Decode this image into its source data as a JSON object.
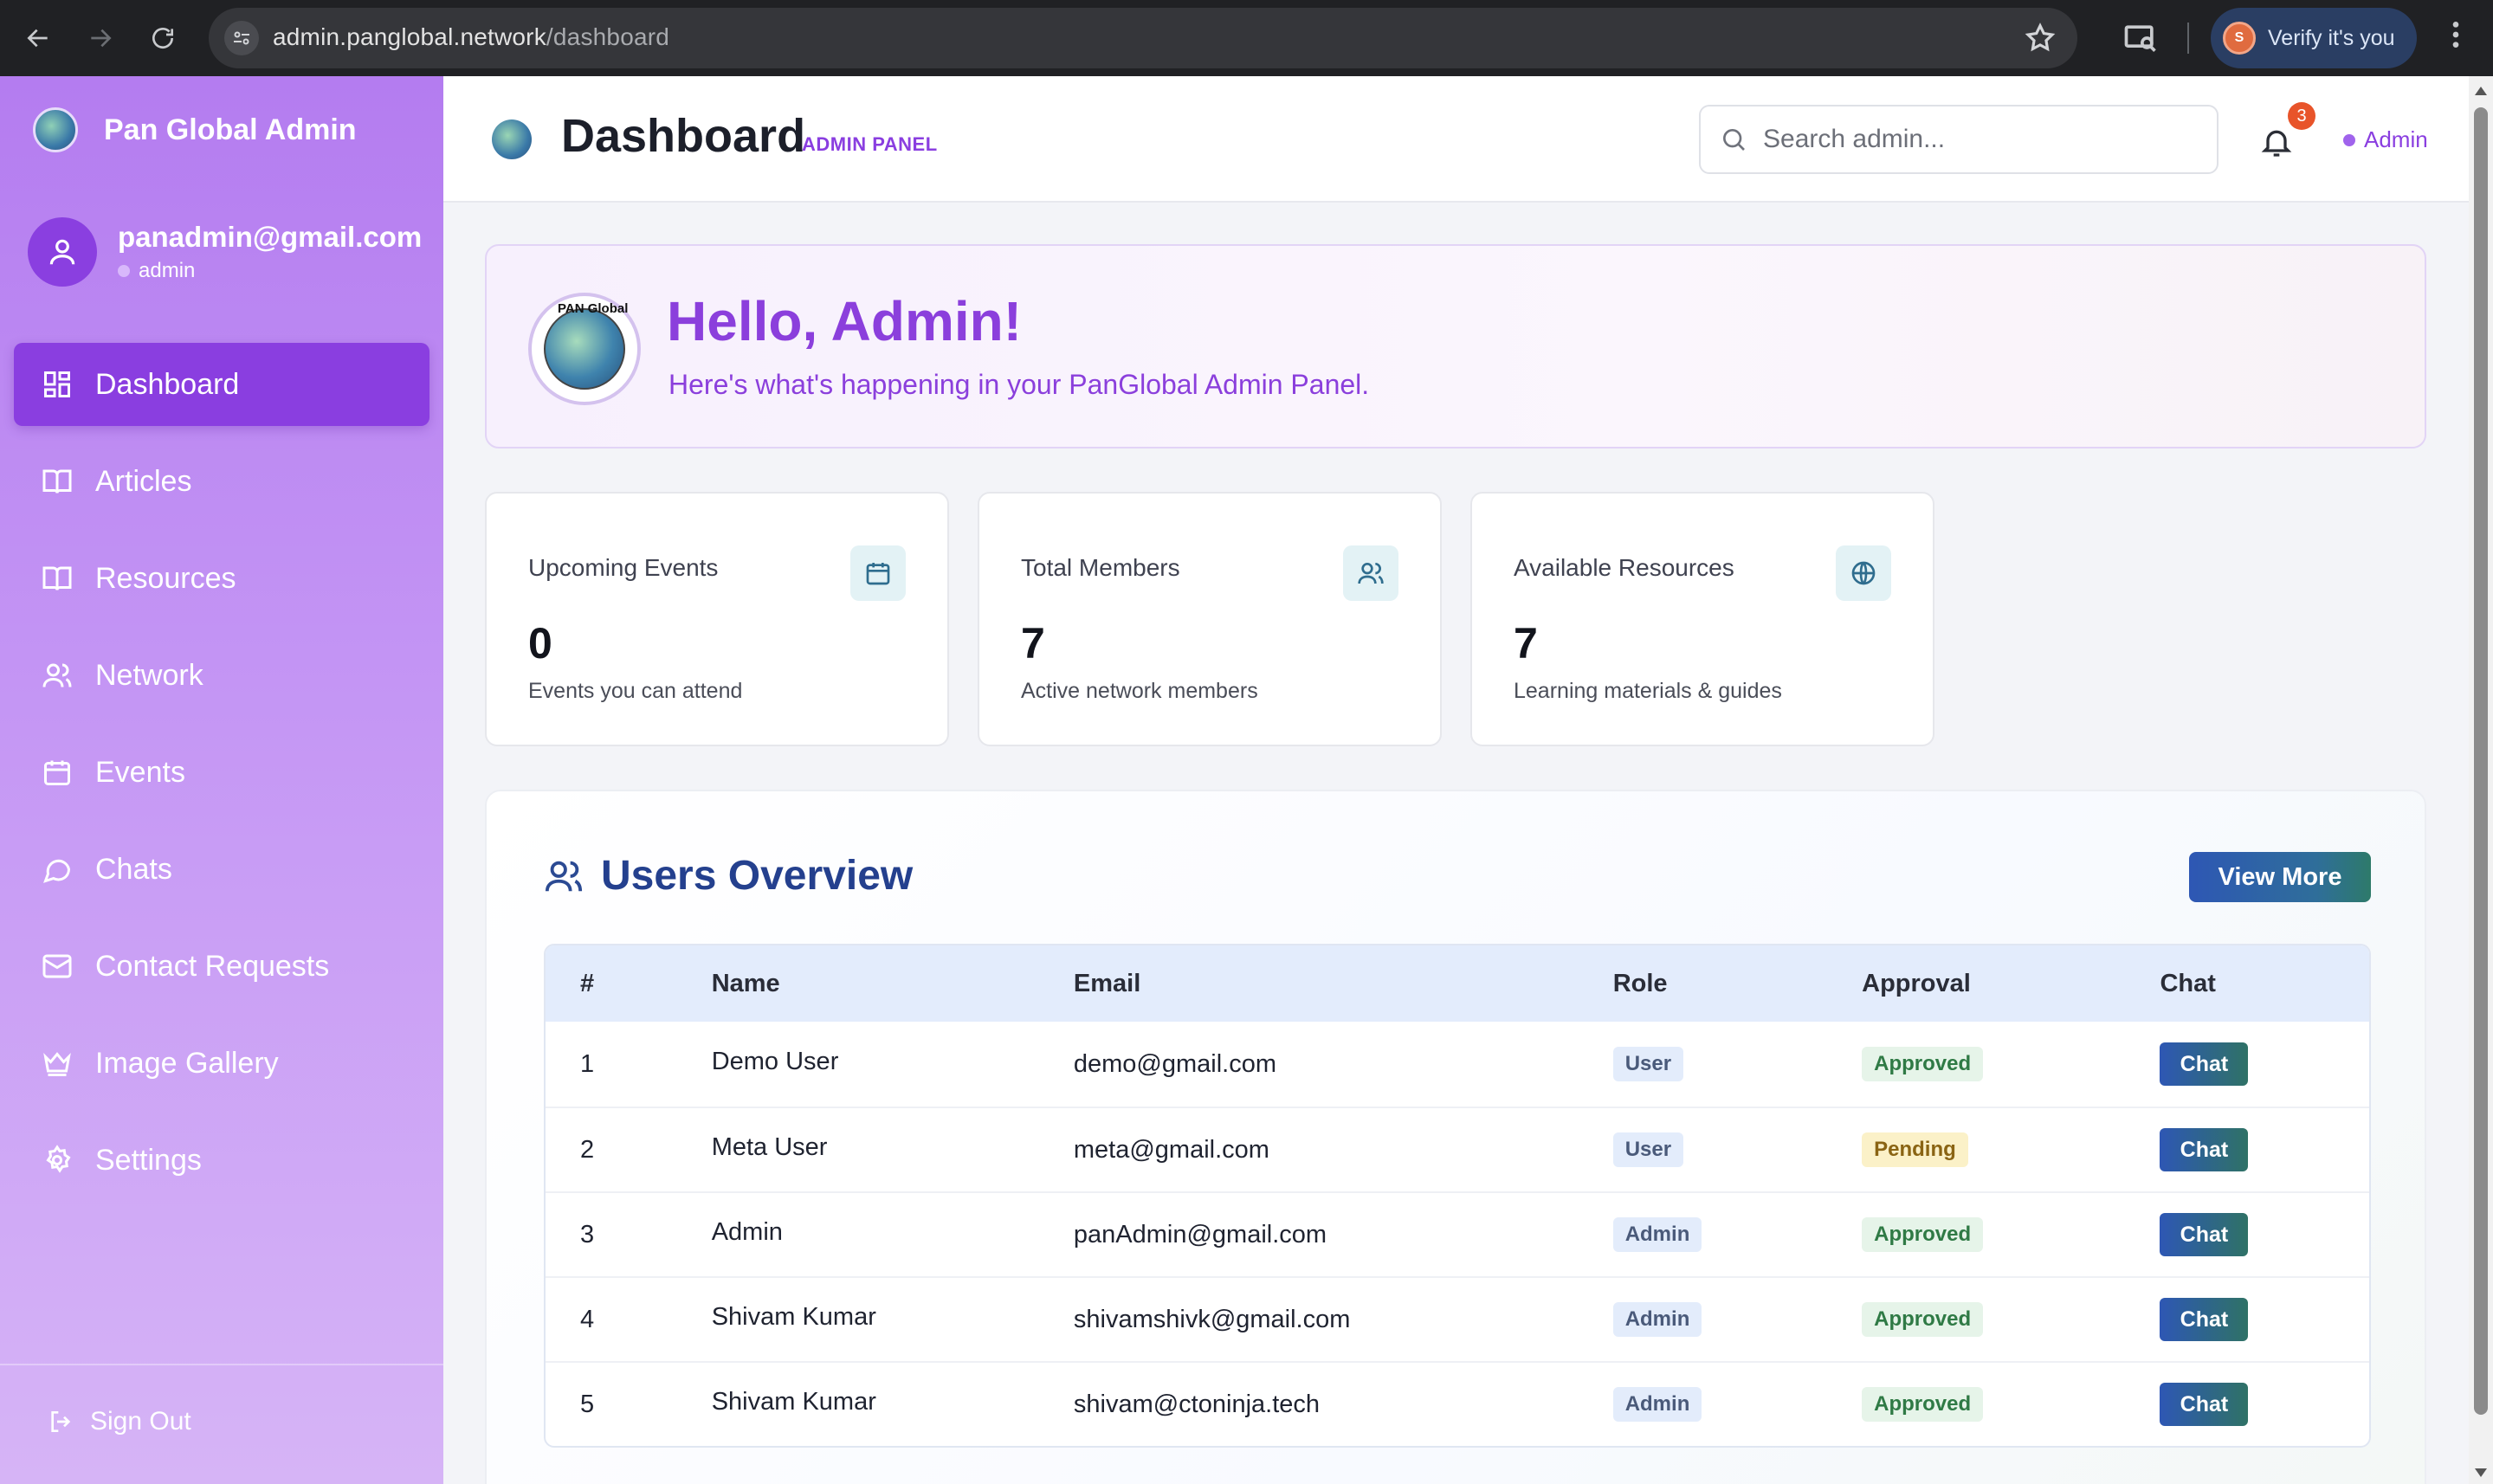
{
  "browser": {
    "url_host": "admin.panglobal.network",
    "url_path": "/dashboard",
    "profile_initial": "S",
    "verify_label": "Verify it's you"
  },
  "sidebar": {
    "brand": "Pan Global Admin",
    "user_email": "panadmin@gmail.com",
    "user_role": "admin",
    "items": [
      {
        "label": "Dashboard",
        "icon": "dashboard-icon",
        "active": true
      },
      {
        "label": "Articles",
        "icon": "book-icon"
      },
      {
        "label": "Resources",
        "icon": "book-icon"
      },
      {
        "label": "Network",
        "icon": "users-icon"
      },
      {
        "label": "Events",
        "icon": "calendar-icon"
      },
      {
        "label": "Chats",
        "icon": "chat-icon"
      },
      {
        "label": "Contact Requests",
        "icon": "mail-icon"
      },
      {
        "label": "Image Gallery",
        "icon": "crown-icon"
      },
      {
        "label": "Settings",
        "icon": "gear-icon"
      }
    ],
    "sign_out": "Sign Out"
  },
  "header": {
    "title": "Dashboard",
    "badge": "ADMIN PANEL",
    "search_placeholder": "Search admin...",
    "notification_count": "3",
    "user_label": "Admin"
  },
  "hello": {
    "seal_text": "PAN Global",
    "title": "Hello, Admin!",
    "subtitle": "Here's what's happening in your PanGlobal Admin Panel."
  },
  "stats": [
    {
      "label": "Upcoming Events",
      "value": "0",
      "desc": "Events you can attend",
      "icon": "calendar-icon"
    },
    {
      "label": "Total Members",
      "value": "7",
      "desc": "Active network members",
      "icon": "users-icon"
    },
    {
      "label": "Available Resources",
      "value": "7",
      "desc": "Learning materials & guides",
      "icon": "globe-icon"
    }
  ],
  "users": {
    "title": "Users Overview",
    "view_more": "View More",
    "columns": [
      "#",
      "Name",
      "Email",
      "Role",
      "Approval",
      "Chat"
    ],
    "rows": [
      {
        "n": "1",
        "name": "Demo User",
        "email": "demo@gmail.com",
        "role": "User",
        "approval": "Approved",
        "chat": "Chat"
      },
      {
        "n": "2",
        "name": "Meta User",
        "email": "meta@gmail.com",
        "role": "User",
        "approval": "Pending",
        "chat": "Chat"
      },
      {
        "n": "3",
        "name": "Admin",
        "email": "panAdmin@gmail.com",
        "role": "Admin",
        "approval": "Approved",
        "chat": "Chat"
      },
      {
        "n": "4",
        "name": "Shivam Kumar",
        "email": "shivamshivk@gmail.com",
        "role": "Admin",
        "approval": "Approved",
        "chat": "Chat"
      },
      {
        "n": "5",
        "name": "Shivam Kumar",
        "email": "shivam@ctoninja.tech",
        "role": "Admin",
        "approval": "Approved",
        "chat": "Chat"
      }
    ]
  },
  "colors": {
    "accent": "#8a3ee0",
    "sidebar_top": "#b47cf0",
    "table_head": "#e3ecfc",
    "users_title": "#24408e"
  }
}
